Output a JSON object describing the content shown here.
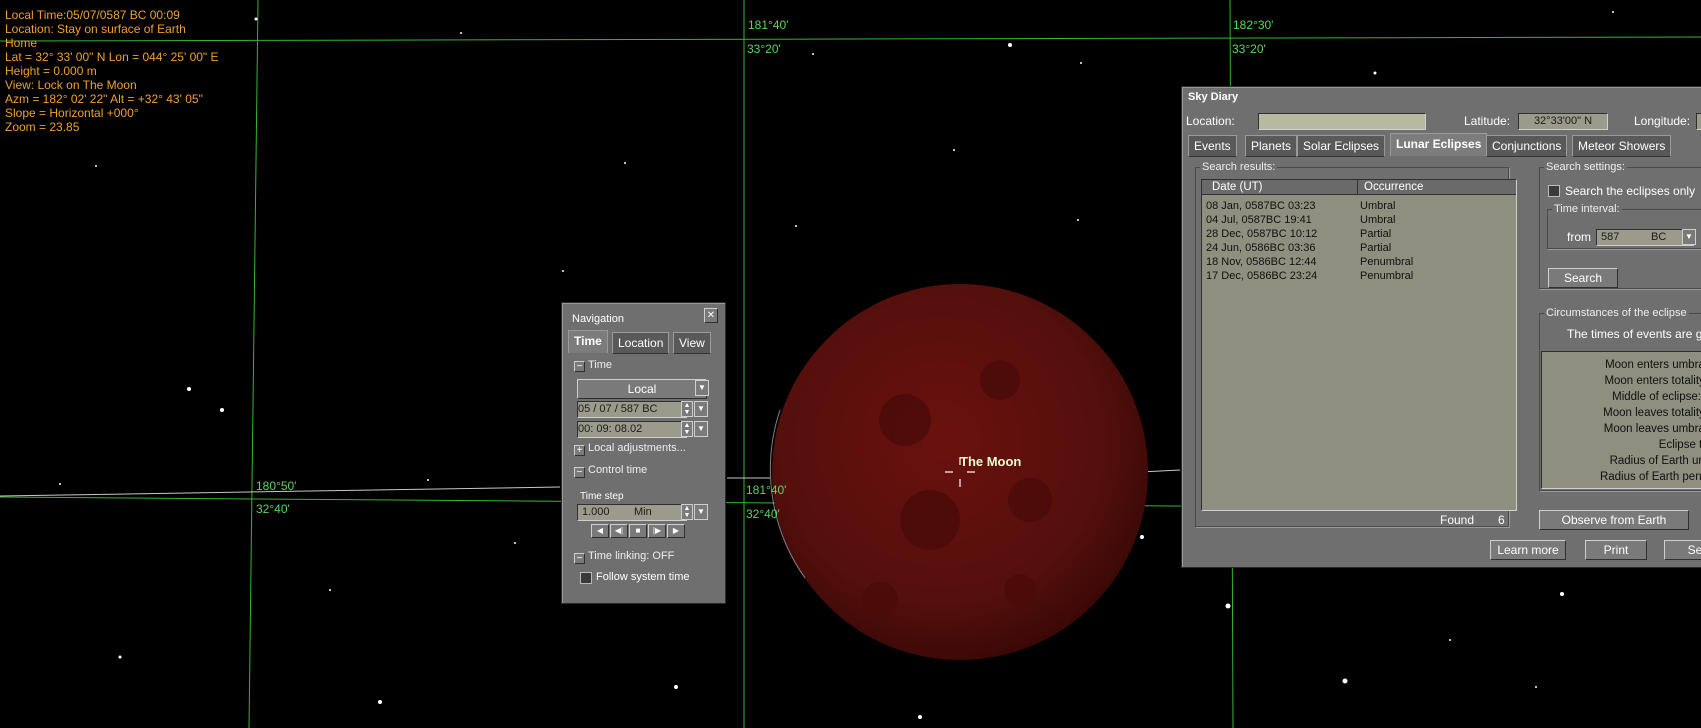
{
  "info": {
    "local_time": "Local Time:05/07/0587 BC 00:09",
    "location": "Location: Stay on surface of Earth",
    "home": "Home",
    "latlon": "Lat = 32° 33' 00\" N   Lon = 044° 25' 00\" E",
    "height": "Height = 0.000 m",
    "view": "View: Lock on The Moon",
    "azm_alt": "Azm = 182° 02' 22\"  Alt = +32° 43' 05\"",
    "slope": "Slope = Horizontal +000°",
    "zoom": "Zoom = 23.85"
  },
  "grid_labels": {
    "lon_181_40": "181°40'",
    "lat_33_20_a": "33°20'",
    "lon_182_30": "182°30'",
    "lat_33_20_b": "33°20'",
    "lon_180_50": "180°50'",
    "lat_32_40_a": "32°40'",
    "lon_181_40_b": "181°40'",
    "lat_32_40_b": "32°40'"
  },
  "moon_label": "The Moon",
  "colors": {
    "moon": "#5a0d0b",
    "grid": "#35b535",
    "info_text": "#f0a030",
    "panel": "#6f6f6f",
    "field": "#9a9b8a"
  },
  "navigation": {
    "title": "Navigation",
    "close": "✕",
    "tabs": [
      "Time",
      "Location",
      "View"
    ],
    "time_section": "Time",
    "time_mode": "Local",
    "date": "05 / 07 /  587   BC",
    "time": "00:  09: 08.02",
    "local_adjustments": "Local adjustments...",
    "control_time": "Control time",
    "time_step_label": "Time step",
    "time_step_value": "1.000",
    "time_step_unit": "Min",
    "controls": [
      "◀",
      "◀|",
      "■",
      "|▶",
      "▶"
    ],
    "time_linking": "Time linking: OFF",
    "follow_system_time": "Follow system time",
    "minus": "−",
    "plus": "+"
  },
  "sky_diary": {
    "title": "Sky Diary",
    "location_label": "Location:",
    "location_value": "",
    "latitude_label": "Latitude:",
    "latitude_value": "32°33'00\" N",
    "longitude_label": "Longitude:",
    "tabs": [
      "Events",
      "Planets",
      "Solar Eclipses",
      "Lunar Eclipses",
      "Conjunctions",
      "Meteor Showers"
    ],
    "search_results_label": "Search results:",
    "columns": [
      "Date (UT)",
      "Occurrence"
    ],
    "rows": [
      {
        "date": "08 Jan, 0587BC 03:23",
        "occ": "Umbral"
      },
      {
        "date": "04 Jul, 0587BC 19:41",
        "occ": "Umbral"
      },
      {
        "date": "28 Dec, 0587BC 10:12",
        "occ": "Partial"
      },
      {
        "date": "24 Jun, 0586BC 03:36",
        "occ": "Partial"
      },
      {
        "date": "18 Nov, 0586BC 12:44",
        "occ": "Penumbral"
      },
      {
        "date": "17 Dec, 0586BC 23:24",
        "occ": "Penumbral"
      }
    ],
    "found_label": "Found",
    "found_count": "6",
    "search_settings_label": "Search settings:",
    "search_only_label": "Search the eclipses only",
    "time_interval_label": "Time interval:",
    "from_label": "from",
    "from_year": "587",
    "from_era": "BC",
    "search_button": "Search",
    "circumstances_label": "Circumstances of the eclipse",
    "times_note": "The times of events are g",
    "circumstances": [
      "Moon enters umbra:",
      "Moon enters totality:",
      "Middle of eclipse: (",
      "Moon leaves totality:",
      "Moon leaves umbra:",
      "Eclipse ty",
      "Radius of Earth um",
      "Radius of Earth penu"
    ],
    "observe_button": "Observe from Earth",
    "learn_more_button": "Learn more",
    "print_button": "Print",
    "se_button": "Se"
  }
}
